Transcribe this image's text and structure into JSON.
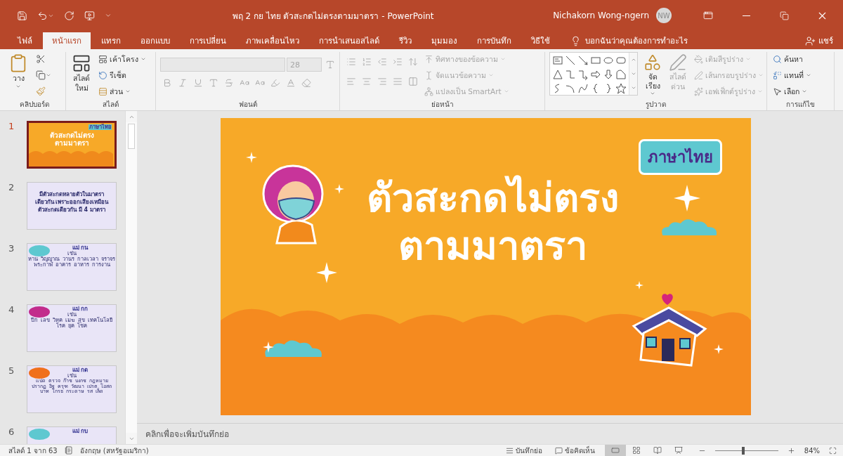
{
  "window": {
    "title": "พฤ 2 กย ไทย ตัวสะกดไม่ตรงตามมาตรา  -  PowerPoint",
    "user": "Nichakorn Wong-ngern",
    "user_initials": "NW"
  },
  "tabs": [
    {
      "label": "ไฟล์",
      "selected": false
    },
    {
      "label": "หน้าแรก",
      "selected": true
    },
    {
      "label": "แทรก",
      "selected": false
    },
    {
      "label": "ออกแบบ",
      "selected": false
    },
    {
      "label": "การเปลี่ยน",
      "selected": false
    },
    {
      "label": "ภาพเคลื่อนไหว",
      "selected": false
    },
    {
      "label": "การนำเสนอสไลด์",
      "selected": false
    },
    {
      "label": "รีวิว",
      "selected": false
    },
    {
      "label": "มุมมอง",
      "selected": false
    },
    {
      "label": "การบันทึก",
      "selected": false
    },
    {
      "label": "วิธีใช้",
      "selected": false
    }
  ],
  "tell_me": {
    "placeholder": "บอกฉันว่าคุณต้องการทำอะไร"
  },
  "share": "แชร์",
  "ribbon": {
    "clipboard": {
      "label": "คลิปบอร์ด",
      "paste": "วาง"
    },
    "slides": {
      "label": "สไลด์",
      "new_slide": [
        "สไลด์",
        "ใหม่"
      ],
      "layout": "เค้าโครง",
      "reset": "รีเซ็ต",
      "section": "ส่วน"
    },
    "font": {
      "label": "ฟอนต์",
      "size": "28",
      "disabled": true
    },
    "paragraph": {
      "label": "ย่อหน้า",
      "items": [
        {
          "label": "ทิศทางของข้อความ",
          "disabled": true
        },
        {
          "label": "จัดแนวข้อความ",
          "disabled": true
        },
        {
          "label": "แปลงเป็น SmartArt",
          "disabled": true
        }
      ]
    },
    "drawing": {
      "label": "รูปวาด",
      "arrange": "จัดเรียง",
      "quick_styles": [
        "สไลด์",
        "ด่วน"
      ],
      "format_items": [
        {
          "label": "เติมสีรูปร่าง",
          "disabled": true
        },
        {
          "label": "เส้นกรอบรูปร่าง",
          "disabled": true
        },
        {
          "label": "เอฟเฟ็กต์รูปร่าง",
          "disabled": true
        }
      ]
    },
    "editing": {
      "label": "การแก้ไข",
      "find": "ค้นหา",
      "replace": "แทนที่",
      "select": "เลือก"
    }
  },
  "thumbnails": [
    {
      "number": "1",
      "selected": true,
      "kind": "title",
      "badge": "ภาษาไทย",
      "lines": [
        "ตัวสะกดไม่ตรง",
        "ตามมาตรา"
      ]
    },
    {
      "number": "2",
      "selected": false,
      "kind": "text",
      "lines": [
        "มีตัวสะกดหลายตัวในมาตรา",
        "เดียวกัน เพราะออกเสียงเหมือน",
        "ตัวสะกดเดียวกัน มี 4 มาตรา"
      ]
    },
    {
      "number": "3",
      "selected": false,
      "kind": "words",
      "color": "#5ec8d0",
      "heading": "แม่ กน",
      "sub": "เช่น",
      "words": [
        "หาน",
        "วิญญาณ",
        "วานร",
        "กาลเวลา",
        "จราจร",
        "พระกาฬ",
        "อาคาร",
        "อาหาร",
        "การงาน"
      ]
    },
    {
      "number": "4",
      "selected": false,
      "kind": "words",
      "color": "#c22c8c",
      "heading": "แม่ กก",
      "sub": "เช่น",
      "words": [
        "ปีก",
        "เลข",
        "วิหค",
        "เมฆ",
        "สุข",
        "เทคโนโลยี",
        "โรค",
        "ยุค",
        "โชค"
      ]
    },
    {
      "number": "5",
      "selected": false,
      "kind": "words",
      "color": "#f0701c",
      "heading": "แม่ กด",
      "sub": "เช่น",
      "words": [
        "แปด",
        "ตรวจ",
        "ก๊าซ",
        "บงกช",
        "กฎหมาย",
        "ปรากฏ",
        "อิฐ",
        "ครุฑ",
        "วัฒนา",
        "เปรต",
        "โอสถ",
        "บาท",
        "โกรธ",
        "กระดาษ",
        "รส",
        "เล็ด"
      ]
    },
    {
      "number": "6",
      "selected": false,
      "kind": "words",
      "color": "#5ec8d0",
      "heading": "แม่ กบ"
    }
  ],
  "slide": {
    "badge": "ภาษาไทย",
    "title_lines": [
      "ตัวสะกดไม่ตรง",
      "ตามมาตรา"
    ]
  },
  "notes": {
    "placeholder": "คลิกเพื่อจะเพิ่มบันทึกย่อ"
  },
  "status_bar": {
    "slide_count": "สไลด์ 1 จาก 63",
    "language": "อังกฤษ (สหรัฐอเมริกา)",
    "notes": "บันทึกย่อ",
    "comments": "ข้อคิดเห็น",
    "views": [
      {
        "kind": "normal",
        "selected": true
      },
      {
        "kind": "sorter",
        "selected": false
      },
      {
        "kind": "reading",
        "selected": false
      },
      {
        "kind": "slideshow",
        "selected": false
      }
    ],
    "zoom": {
      "level": 0.45,
      "reading": "84%"
    }
  }
}
